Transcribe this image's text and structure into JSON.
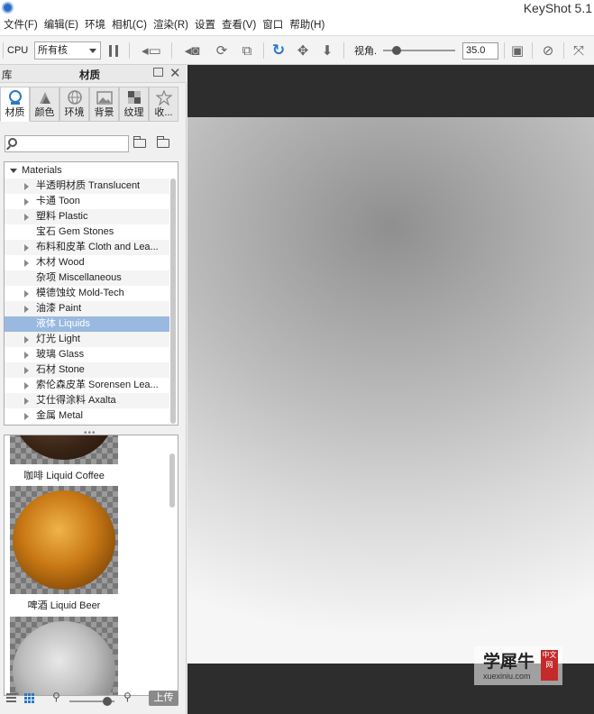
{
  "window": {
    "title": "KeyShot 5.1"
  },
  "menu": [
    "文件(F)",
    "编辑(E)",
    "环境",
    "相机(C)",
    "渲染(R)",
    "设置",
    "查看(V)",
    "窗口",
    "帮助(H)"
  ],
  "toolbar": {
    "cpu_label": "CPU",
    "cores_selected": "所有核",
    "fov_label": "视角.",
    "fov_value": "35.0"
  },
  "panel": {
    "library_label": "库",
    "title": "材质",
    "tabs": [
      {
        "label": "材质",
        "icon": "material-icon"
      },
      {
        "label": "颜色",
        "icon": "color-palette-icon"
      },
      {
        "label": "环境",
        "icon": "globe-icon"
      },
      {
        "label": "背景",
        "icon": "image-icon"
      },
      {
        "label": "纹理",
        "icon": "texture-icon"
      },
      {
        "label": "收...",
        "icon": "star-icon"
      }
    ],
    "search_placeholder": ""
  },
  "tree": {
    "root": "Materials",
    "items": [
      {
        "label": "半透明材质 Translucent",
        "expandable": true
      },
      {
        "label": "卡通 Toon",
        "expandable": true
      },
      {
        "label": "塑料 Plastic",
        "expandable": true
      },
      {
        "label": "宝石 Gem Stones",
        "expandable": false
      },
      {
        "label": "布料和皮革 Cloth and Lea...",
        "expandable": true
      },
      {
        "label": "木材 Wood",
        "expandable": true
      },
      {
        "label": "杂项 Miscellaneous",
        "expandable": false
      },
      {
        "label": "模德蚀纹 Mold-Tech",
        "expandable": true
      },
      {
        "label": "油漆 Paint",
        "expandable": true
      },
      {
        "label": "液体 Liquids",
        "expandable": false,
        "selected": true
      },
      {
        "label": "灯光 Light",
        "expandable": true
      },
      {
        "label": "玻璃 Glass",
        "expandable": true
      },
      {
        "label": "石材 Stone",
        "expandable": true
      },
      {
        "label": "索伦森皮革 Sorensen Lea...",
        "expandable": true
      },
      {
        "label": "艾仕得涂料 Axalta",
        "expandable": true
      },
      {
        "label": "金属 Metal",
        "expandable": true
      }
    ]
  },
  "thumbnails": [
    {
      "caption": "咖啡 Liquid Coffee"
    },
    {
      "caption": "啤酒 Liquid Beer"
    },
    {
      "caption": ""
    }
  ],
  "bottom": {
    "upload_label": "上传"
  },
  "watermark": {
    "text": "学犀牛",
    "url": "xuexiniu.com",
    "seal": "中文网"
  }
}
